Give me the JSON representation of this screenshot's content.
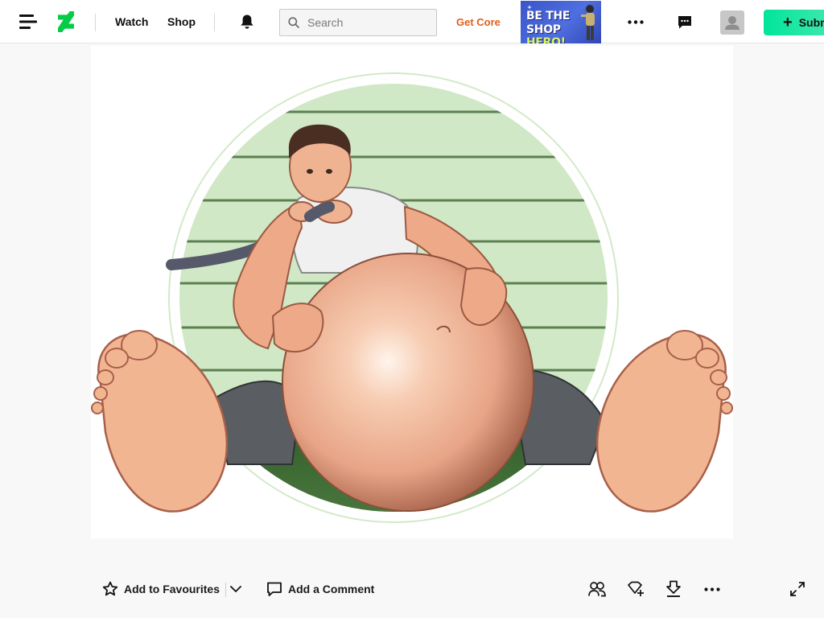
{
  "topbar": {
    "nav_watch": "Watch",
    "nav_shop": "Shop",
    "search_placeholder": "Search",
    "get_core": "Get Core",
    "submit_label": "Submit",
    "icons": {
      "menu": "menu-icon",
      "logo": "deviantart-logo",
      "bell": "bell-icon",
      "search": "search-icon",
      "more": "more-icon",
      "chat": "chat-icon",
      "avatar": "avatar-icon",
      "plus": "plus-icon"
    }
  },
  "ad": {
    "line1": "BE THE",
    "line2_a": "SHOP ",
    "line2_b": "HERO!"
  },
  "artwork": {
    "background_color": "#ffffff",
    "circle_fill": "#d2e9c8",
    "circle_ring": "#5a8a4a"
  },
  "actions": {
    "favourite_label": "Add to Favourites",
    "comment_label": "Add a Comment",
    "icons": [
      "star-icon",
      "chevron-down-icon",
      "comment-icon",
      "watchers-icon",
      "badge-icon",
      "download-icon",
      "more-icon",
      "expand-icon"
    ]
  },
  "colors": {
    "accent_green": "#05cc47",
    "get_core_orange": "#e35d18",
    "submit_green": "#00e59b"
  }
}
